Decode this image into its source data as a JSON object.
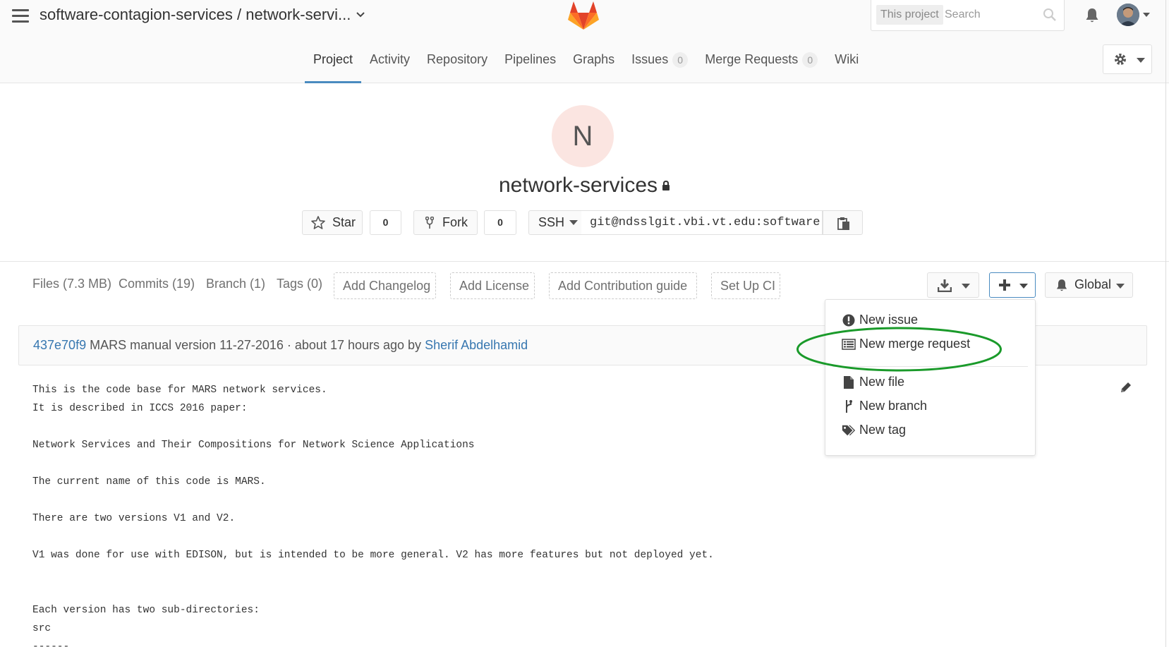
{
  "header": {
    "title": "software-contagion-services / network-servi...",
    "search": {
      "scope": "This project",
      "placeholder": "Search"
    }
  },
  "nav": {
    "items": [
      {
        "label": "Project"
      },
      {
        "label": "Activity"
      },
      {
        "label": "Repository"
      },
      {
        "label": "Pipelines"
      },
      {
        "label": "Graphs"
      },
      {
        "label": "Issues",
        "badge": "0"
      },
      {
        "label": "Merge Requests",
        "badge": "0"
      },
      {
        "label": "Wiki"
      }
    ]
  },
  "project": {
    "avatar_letter": "N",
    "name": "network-services",
    "star_label": "Star",
    "star_count": "0",
    "fork_label": "Fork",
    "fork_count": "0",
    "clone_protocol": "SSH",
    "clone_url": "git@ndsslgit.vbi.vt.edu:software-"
  },
  "stats": {
    "files": "Files (7.3 MB)",
    "commits": "Commits (19)",
    "branch": "Branch (1)",
    "tags": "Tags (0)",
    "add_changelog": "Add Changelog",
    "add_license": "Add License",
    "add_contribution": "Add Contribution guide",
    "setup_ci": "Set Up CI",
    "notification_level": "Global"
  },
  "dropdown": {
    "items": [
      {
        "label": "New issue"
      },
      {
        "label": "New merge request"
      },
      {
        "label": "New file"
      },
      {
        "label": "New branch"
      },
      {
        "label": "New tag"
      }
    ]
  },
  "commit": {
    "sha": "437e70f9",
    "message": "MARS manual version 11-27-2016 · about 17 hours ago by",
    "author": "Sherif Abdelhamid"
  },
  "readme": {
    "text": "This is the code base for MARS network services.\nIt is described in ICCS 2016 paper:\n\nNetwork Services and Their Compositions for Network Science Applications\n\nThe current name of this code is MARS.\n\nThere are two versions V1 and V2.\n\nV1 was done for use with EDISON, but is intended to be more general. V2 has more features but not deployed yet.\n\n\nEach version has two sub-directories:\nsrc\n------"
  },
  "colors": {
    "accent": "#4a8bc0",
    "link": "#3777b0",
    "highlight": "#1a9a2a",
    "avatar_bg": "#fbe5e1"
  }
}
